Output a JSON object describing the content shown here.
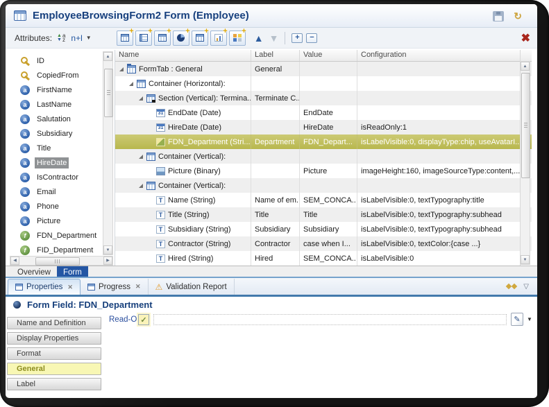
{
  "window": {
    "title": "EmployeeBrowsingForm2 Form (Employee)"
  },
  "toolbar": {
    "attributes_label": "Attributes:",
    "sort_mode": "n+l",
    "icon_buttons": [
      {
        "name": "add-field-button"
      },
      {
        "name": "add-labeled-field-button"
      },
      {
        "name": "add-list-field-button"
      },
      {
        "name": "add-pie-widget-button"
      },
      {
        "name": "add-table-widget-button"
      },
      {
        "name": "add-chart-widget-button"
      },
      {
        "name": "add-mosaic-widget-button"
      }
    ]
  },
  "attributes": {
    "items": [
      {
        "label": "ID",
        "icon": "key",
        "selected": false
      },
      {
        "label": "CopiedFrom",
        "icon": "key",
        "selected": false
      },
      {
        "label": "FirstName",
        "icon": "attribute",
        "selected": false
      },
      {
        "label": "LastName",
        "icon": "attribute",
        "selected": false
      },
      {
        "label": "Salutation",
        "icon": "attribute",
        "selected": false
      },
      {
        "label": "Subsidiary",
        "icon": "attribute",
        "selected": false
      },
      {
        "label": "Title",
        "icon": "attribute",
        "selected": false
      },
      {
        "label": "HireDate",
        "icon": "attribute",
        "selected": true
      },
      {
        "label": "IsContractor",
        "icon": "attribute",
        "selected": false
      },
      {
        "label": "Email",
        "icon": "attribute",
        "selected": false
      },
      {
        "label": "Phone",
        "icon": "attribute",
        "selected": false
      },
      {
        "label": "Picture",
        "icon": "attribute",
        "selected": false
      },
      {
        "label": "FDN_Department",
        "icon": "function",
        "selected": false
      },
      {
        "label": "FID_Department",
        "icon": "function",
        "selected": false
      }
    ]
  },
  "tree": {
    "columns": [
      "Name",
      "Label",
      "Value",
      "Configuration"
    ],
    "rows": [
      {
        "name": "FormTab : General",
        "label": "General",
        "value": "",
        "config": "",
        "depth": 0,
        "icon": "formtab",
        "expander": true,
        "highlight": false
      },
      {
        "name": "Container (Horizontal):",
        "label": "",
        "value": "",
        "config": "",
        "depth": 1,
        "icon": "container",
        "expander": true,
        "highlight": false
      },
      {
        "name": "Section (Vertical): Termina...",
        "label": "Terminate C...",
        "value": "",
        "config": "",
        "depth": 2,
        "icon": "section",
        "expander": true,
        "highlight": false
      },
      {
        "name": "EndDate (Date)",
        "label": "",
        "value": "EndDate",
        "config": "",
        "depth": 3,
        "icon": "date",
        "expander": false,
        "highlight": false
      },
      {
        "name": "HireDate (Date)",
        "label": "",
        "value": "HireDate",
        "config": "isReadOnly:1",
        "depth": 3,
        "icon": "date",
        "expander": false,
        "highlight": false
      },
      {
        "name": "FDN_Department (Stri...",
        "label": "Department",
        "value": "FDN_Depart...",
        "config": "isLabelVisible:0, displayType:chip, useAvatarI...",
        "depth": 3,
        "icon": "image",
        "expander": false,
        "highlight": true
      },
      {
        "name": "Container (Vertical):",
        "label": "",
        "value": "",
        "config": "",
        "depth": 2,
        "icon": "container",
        "expander": true,
        "highlight": false
      },
      {
        "name": "Picture (Binary)",
        "label": "",
        "value": "Picture",
        "config": "imageHeight:160, imageSourceType:content,...",
        "depth": 3,
        "icon": "picture",
        "expander": false,
        "highlight": false
      },
      {
        "name": "Container (Vertical):",
        "label": "",
        "value": "",
        "config": "",
        "depth": 2,
        "icon": "container",
        "expander": true,
        "highlight": false
      },
      {
        "name": "Name (String)",
        "label": "Name of em...",
        "value": "SEM_CONCA..",
        "config": "isLabelVisible:0, textTypography:title",
        "depth": 3,
        "icon": "text",
        "expander": false,
        "highlight": false
      },
      {
        "name": "Title (String)",
        "label": "Title",
        "value": "Title",
        "config": "isLabelVisible:0, textTypography:subhead",
        "depth": 3,
        "icon": "text",
        "expander": false,
        "highlight": false
      },
      {
        "name": "Subsidiary (String)",
        "label": "Subsidiary",
        "value": "Subsidiary",
        "config": "isLabelVisible:0, textTypography:subhead",
        "depth": 3,
        "icon": "text",
        "expander": false,
        "highlight": false
      },
      {
        "name": "Contractor (String)",
        "label": "Contractor",
        "value": "case when I...",
        "config": "isLabelVisible:0, textColor:{case ...}",
        "depth": 3,
        "icon": "text",
        "expander": false,
        "highlight": false
      },
      {
        "name": "Hired (String)",
        "label": "Hired",
        "value": "SEM_CONCA..",
        "config": "isLabelVisible:0",
        "depth": 3,
        "icon": "text",
        "expander": false,
        "highlight": false
      }
    ]
  },
  "editor_tabs": [
    {
      "label": "Overview",
      "active": false
    },
    {
      "label": "Form",
      "active": true
    }
  ],
  "view_tabs": [
    {
      "label": "Properties",
      "icon": "properties-view",
      "closable": true,
      "active": true
    },
    {
      "label": "Progress",
      "icon": "progress-view",
      "closable": true,
      "active": false
    },
    {
      "label": "Validation Report",
      "icon": "warning",
      "closable": false,
      "active": false
    }
  ],
  "properties_panel": {
    "title": "Form Field: FDN_Department",
    "readonly_label": "Read-Only:",
    "readonly_checked": true,
    "sections": [
      {
        "label": "Name and Definition",
        "selected": false
      },
      {
        "label": "Display Properties",
        "selected": false
      },
      {
        "label": "Format",
        "selected": false
      },
      {
        "label": "General",
        "selected": true
      },
      {
        "label": "Label",
        "selected": false
      }
    ]
  },
  "glyphs": {
    "sync": "↻",
    "dropdown_caret": "▼",
    "view_menu": "▽",
    "close_tab": "✕",
    "close_editor": "✖",
    "warning": "⚠",
    "check": "✓",
    "edit": "✎",
    "up_arrow": "▲",
    "down_arrow": "▼",
    "plus": "+",
    "minus": "−",
    "sort_a": "a",
    "sort_z": "z",
    "scroll_up": "▲",
    "scroll_down": "▼",
    "scroll_left": "◀",
    "scroll_right": "▶",
    "date_icon_text": "31",
    "text_icon_text": "T"
  },
  "colors": {
    "accent_blue": "#2456a4",
    "highlight_row": "#c0bf5e",
    "selected_attribute_bg": "#8f9294",
    "accordion_selected_bg": "#f8f7b4",
    "title_text": "#17407e",
    "close_red": "#a8261d"
  }
}
